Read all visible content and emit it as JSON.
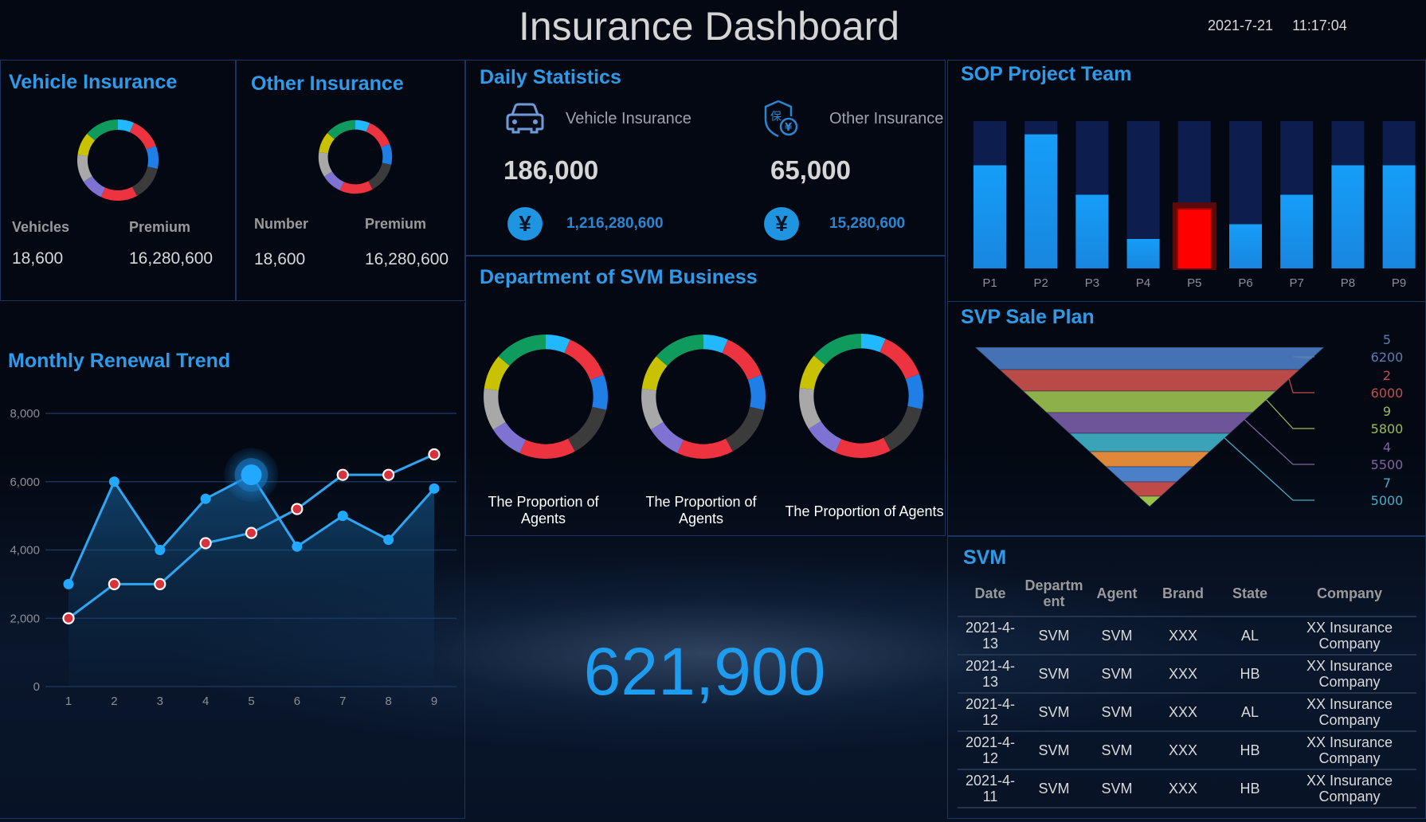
{
  "header": {
    "title": "Insurance Dashboard",
    "date": "2021-7-21",
    "time": "11:17:04"
  },
  "vehicle_insurance": {
    "title": "Vehicle Insurance",
    "labels": [
      "Vehicles",
      "Premium"
    ],
    "values": [
      "18,600",
      "16,280,600"
    ]
  },
  "other_insurance": {
    "title": "Other Insurance",
    "labels": [
      "Number",
      "Premium"
    ],
    "values": [
      "18,600",
      "16,280,600"
    ]
  },
  "daily_statistics": {
    "title": "Daily Statistics",
    "items": [
      {
        "icon": "car-icon",
        "label": "Vehicle Insurance",
        "count": "186,000",
        "money": "1,216,280,600"
      },
      {
        "icon": "insurance-shield-icon",
        "label": "Other Insurance",
        "count": "65,000",
        "money": "15,280,600"
      }
    ],
    "currency_symbol": "¥"
  },
  "department": {
    "title": "Department of SVM Business",
    "captions": [
      "The Proportion of Agents",
      "The Proportion of Agents",
      "The Proportion of Agents"
    ]
  },
  "big_number": "621,900",
  "sop_team": {
    "title": "SOP Project Team"
  },
  "sale_plan": {
    "title": "SVP Sale Plan"
  },
  "svm_table": {
    "title": "SVM",
    "columns": [
      "Date",
      "Department",
      "Agent",
      "Brand",
      "State",
      "Company"
    ],
    "rows": [
      [
        "2021-4-13",
        "SVM",
        "SVM",
        "XXX",
        "AL",
        "XX Insurance Company"
      ],
      [
        "2021-4-13",
        "SVM",
        "SVM",
        "XXX",
        "HB",
        "XX Insurance Company"
      ],
      [
        "2021-4-12",
        "SVM",
        "SVM",
        "XXX",
        "AL",
        "XX Insurance Company"
      ],
      [
        "2021-4-12",
        "SVM",
        "SVM",
        "XXX",
        "HB",
        "XX Insurance Company"
      ],
      [
        "2021-4-11",
        "SVM",
        "SVM",
        "XXX",
        "HB",
        "XX Insurance Company"
      ]
    ]
  },
  "chart_data": [
    {
      "id": "monthly-renewal-trend",
      "type": "line",
      "title": "Monthly Renewal Trend",
      "x": [
        1,
        2,
        3,
        4,
        5,
        6,
        7,
        8,
        9
      ],
      "ylim": [
        0,
        8000
      ],
      "yticks": [
        0,
        2000,
        4000,
        6000,
        8000
      ],
      "ytick_labels": [
        "0",
        "2,000",
        "4,000",
        "6,000",
        "8,000"
      ],
      "grid": true,
      "highlighted_point": {
        "series": 0,
        "index": 4
      },
      "series": [
        {
          "name": "series-a",
          "values": [
            3000,
            6000,
            4000,
            5500,
            6200,
            4100,
            5000,
            4300,
            5800
          ],
          "color": "#2ea6f2",
          "area": true
        },
        {
          "name": "series-b",
          "values": [
            2000,
            3000,
            3000,
            4200,
            4500,
            5200,
            6200,
            6200,
            6800
          ],
          "color": "#2ea6f2",
          "marker_color": "#d8323c"
        }
      ]
    },
    {
      "id": "sop-project-team",
      "type": "bar",
      "title": "SOP Project Team",
      "categories": [
        "P1",
        "P2",
        "P3",
        "P4",
        "P5",
        "P6",
        "P7",
        "P8",
        "P9"
      ],
      "values": [
        0.7,
        0.91,
        0.5,
        0.2,
        0.41,
        0.3,
        0.5,
        0.7,
        0.7
      ],
      "max": 1.0,
      "highlight_index": 4,
      "colors": {
        "fill": "#169cf5",
        "track": "#0d1d4d",
        "highlight": "#ff0000"
      }
    },
    {
      "id": "svp-sale-plan",
      "type": "funnel",
      "title": "SVP Sale Plan",
      "segment_colors": [
        "#4472b4",
        "#b94a48",
        "#8db04a",
        "#6e559a",
        "#3aa3b8",
        "#e0883a",
        "#4b80c8",
        "#c04a48",
        "#9cc04a"
      ],
      "labels": [
        {
          "name": "5",
          "value": 6200,
          "color": "#5b7fb2"
        },
        {
          "name": "2",
          "value": 6000,
          "color": "#c0504d"
        },
        {
          "name": "9",
          "value": 5800,
          "color": "#9bbb59"
        },
        {
          "name": "4",
          "value": 5500,
          "color": "#8064a2"
        },
        {
          "name": "7",
          "value": 5000,
          "color": "#4bacc6"
        }
      ]
    },
    {
      "id": "agent-proportion-donuts",
      "type": "pie",
      "segments_colors": [
        "#22b8ff",
        "#ee3340",
        "#1f7fe6",
        "#3b3b3b",
        "#ee3340",
        "#8072d2",
        "#a8a8a8",
        "#c9c200",
        "#0f9a5e"
      ],
      "segments": [
        7,
        14,
        10,
        15,
        16,
        10,
        12,
        10,
        15
      ]
    }
  ]
}
